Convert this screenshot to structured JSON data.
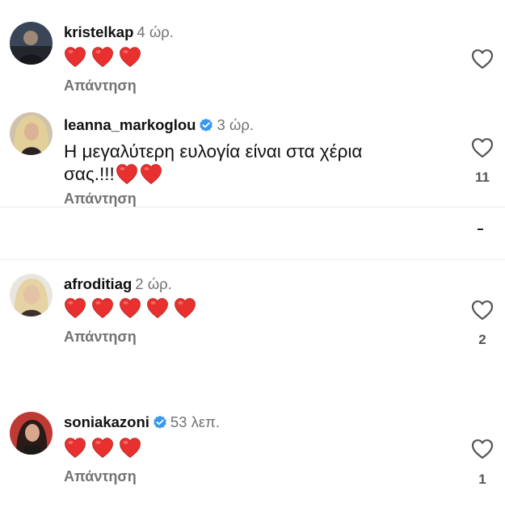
{
  "comments": [
    {
      "username": "kristelkap",
      "time": "4 ώρ.",
      "verified": false,
      "text": "",
      "hearts": 3,
      "reply_label": "Απάντηση",
      "likes": ""
    },
    {
      "username": "leanna_markoglou",
      "time": "3 ώρ.",
      "verified": true,
      "text_line1": "Η μεγαλύτερη ευλογία είναι στα χέρια",
      "text_line2": "σας.!!!",
      "hearts": 2,
      "reply_label": "Απάντηση",
      "likes": "11"
    },
    {
      "username": "afroditiag",
      "time": "2 ώρ.",
      "verified": false,
      "text": "",
      "hearts": 5,
      "reply_label": "Απάντηση",
      "likes": "2"
    },
    {
      "username": "soniakazoni",
      "time": "53 λεπ.",
      "verified": true,
      "text": "",
      "hearts": 3,
      "reply_label": "Απάντηση",
      "likes": "1"
    }
  ],
  "colors": {
    "heart": "#e8312f",
    "verified": "#3897f0",
    "muted": "#737373"
  },
  "icons": {
    "like": "heart-outline-icon",
    "verified": "verified-badge-icon",
    "emoji": "red-heart-emoji"
  }
}
